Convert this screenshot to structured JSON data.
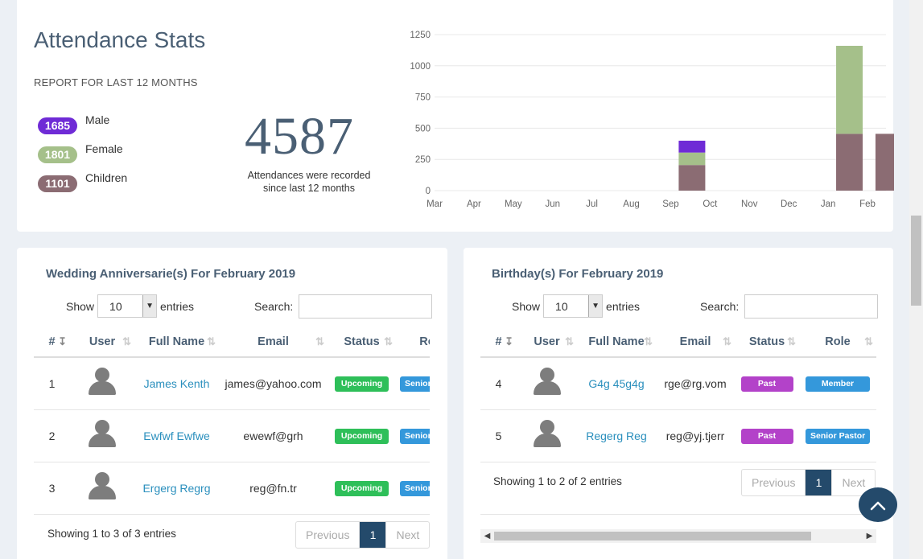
{
  "stats": {
    "title": "Attendance Stats",
    "subtitle": "REPORT FOR LAST 12 MONTHS",
    "legend": [
      {
        "value": "1685",
        "label": "Male",
        "color": "#6f2bd6"
      },
      {
        "value": "1801",
        "label": "Female",
        "color": "#a5c08a"
      },
      {
        "value": "1101",
        "label": "Children",
        "color": "#8b6c73"
      }
    ],
    "total": "4587",
    "total_caption": "Attendances were recorded since last 12 months"
  },
  "chart_data": {
    "type": "bar",
    "stacked": true,
    "categories": [
      "Mar",
      "Apr",
      "May",
      "Jun",
      "Jul",
      "Aug",
      "Sep",
      "Oct",
      "Nov",
      "Dec",
      "Jan",
      "Feb"
    ],
    "series": [
      {
        "name": "Children",
        "color": "#8b6c73",
        "values": [
          0,
          0,
          0,
          0,
          0,
          0,
          205,
          0,
          0,
          0,
          455,
          455
        ]
      },
      {
        "name": "Female",
        "color": "#a5c08a",
        "values": [
          0,
          0,
          0,
          0,
          0,
          0,
          100,
          0,
          0,
          0,
          705,
          0
        ]
      },
      {
        "name": "Male",
        "color": "#6f2bd6",
        "values": [
          0,
          0,
          0,
          0,
          0,
          0,
          95,
          0,
          0,
          0,
          0,
          0
        ]
      }
    ],
    "overlay": {
      "category": "Jan",
      "value": 1150,
      "color": "#a5c08a"
    },
    "yticks": [
      0,
      250,
      500,
      750,
      1000,
      1250
    ],
    "ylim": [
      0,
      1250
    ],
    "grid": true
  },
  "wedding": {
    "title": "Wedding Anniversarie(s) For February 2019",
    "show_label": "Show",
    "page_size": "10",
    "entries_label": "entries",
    "search_label": "Search:",
    "columns": [
      "#",
      "User",
      "Full Name",
      "Email",
      "Status",
      "Role"
    ],
    "rows": [
      {
        "num": "1",
        "name": "James Kenth",
        "email": "james@yahoo.com",
        "status": "Upcoming",
        "role": "Senior Pastor"
      },
      {
        "num": "2",
        "name": "Ewfwf Ewfwe",
        "email": "ewewf@grh",
        "status": "Upcoming",
        "role": "Senior Pastor"
      },
      {
        "num": "3",
        "name": "Ergerg Regrg",
        "email": "reg@fn.tr",
        "status": "Upcoming",
        "role": "Senior Pastor"
      }
    ],
    "info": "Showing 1 to 3 of 3 entries",
    "prev": "Previous",
    "page": "1",
    "next": "Next"
  },
  "birthday": {
    "title": "Birthday(s) For February 2019",
    "show_label": "Show",
    "page_size": "10",
    "entries_label": "entries",
    "search_label": "Search:",
    "columns": [
      "#",
      "User",
      "Full Name",
      "Email",
      "Status",
      "Role"
    ],
    "rows": [
      {
        "num": "4",
        "name": "G4g 45g4g",
        "email": "rge@rg.vom",
        "status": "Past",
        "role": "Member"
      },
      {
        "num": "5",
        "name": "Regerg Reg",
        "email": "reg@yj.tjerr",
        "status": "Past",
        "role": "Senior Pastor"
      }
    ],
    "info": "Showing 1 to 2 of 2 entries",
    "prev": "Previous",
    "page": "1",
    "next": "Next"
  }
}
